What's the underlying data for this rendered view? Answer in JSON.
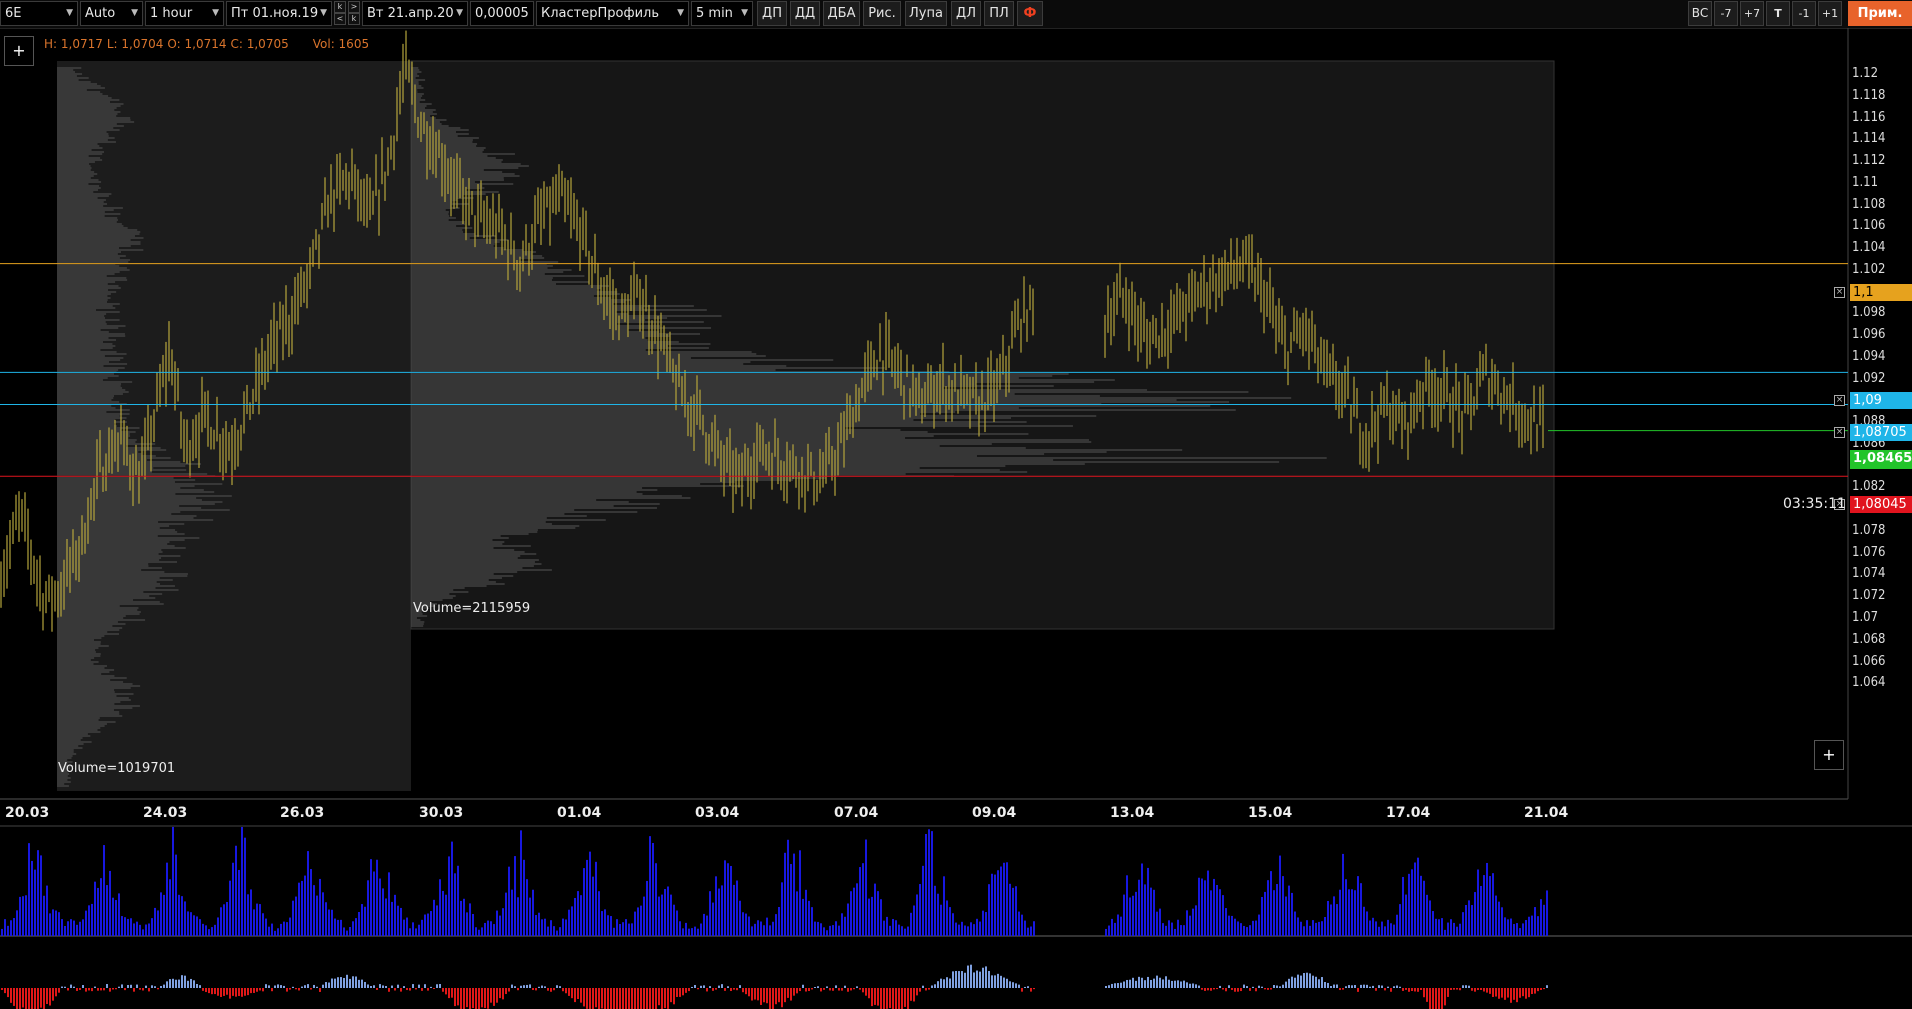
{
  "toolbar": {
    "symbol": "6E",
    "scale_mode": "Auto",
    "timeframe": "1 hour",
    "date_from": "Пт 01.ноя.19",
    "date_to": "Вт 21.апр.20",
    "tick_size": "0,00005",
    "template": "КластерПрофиль",
    "profile_period": "5 min",
    "buttons": [
      "ДП",
      "ДД",
      "ДБА",
      "Рис.",
      "Лупа",
      "ДЛ",
      "ПЛ",
      "Ф"
    ],
    "right_buttons": [
      "ВС",
      "-7",
      "+7",
      "T",
      "-1",
      "+1"
    ],
    "apply_label": "Прим."
  },
  "chart": {
    "ohlc": {
      "high": "H: 1,0717",
      "low": "L: 1,0704",
      "open": "O: 1,0714",
      "close": "C: 1,0705",
      "vol": "Vol: 1605"
    },
    "profile_volumes": [
      "Volume=1019701",
      "Volume=2115959"
    ],
    "timer": "03:35:11",
    "price_ticks": [
      "1.12",
      "1.118",
      "1.116",
      "1.114",
      "1.112",
      "1.11",
      "1.108",
      "1.106",
      "1.104",
      "1.102",
      "1.1",
      "1.098",
      "1.096",
      "1.094",
      "1.092",
      "1.09",
      "1.088",
      "1.086",
      "1.084",
      "1.082",
      "1.08",
      "1.078",
      "1.076",
      "1.074",
      "1.072",
      "1.07",
      "1.068",
      "1.066",
      "1.064"
    ],
    "date_labels": [
      "20.03",
      "24.03",
      "26.03",
      "30.03",
      "01.04",
      "03.04",
      "07.04",
      "09.04",
      "13.04",
      "15.04",
      "17.04",
      "21.04"
    ],
    "level_lines": [
      {
        "label": "1,1",
        "price": 1.1,
        "color": "#e6a21e",
        "text_color": "#000"
      },
      {
        "label": "1,09",
        "price": 1.09,
        "color": "#1fb5e8",
        "text_color": "#fff"
      },
      {
        "label": "1,08705",
        "price": 1.08705,
        "color": "#1fb5e8",
        "text_color": "#fff"
      },
      {
        "label": "1,08045",
        "price": 1.08045,
        "color": "#e0141e",
        "text_color": "#fff"
      }
    ],
    "current_price": {
      "label": "1,08465",
      "price": 1.08465,
      "color": "#22c42a"
    },
    "colors": {
      "candle": "#b5a53c",
      "volume": "#1818e0",
      "delta_pos": "#7fa0e0",
      "delta_neg": "#e01818",
      "profile": "#555555"
    }
  },
  "chart_data": {
    "type": "candlestick",
    "title": "",
    "xlabel": "",
    "ylabel": "",
    "ylim": [
      1.063,
      1.121
    ],
    "x": [
      "20.03",
      "24.03",
      "26.03",
      "30.03",
      "01.04",
      "03.04",
      "07.04",
      "09.04",
      "13.04",
      "15.04",
      "17.04",
      "21.04"
    ],
    "close_path": [
      [
        0,
        1.071
      ],
      [
        20,
        1.077
      ],
      [
        45,
        1.069
      ],
      [
        60,
        1.07
      ],
      [
        80,
        1.074
      ],
      [
        100,
        1.081
      ],
      [
        120,
        1.084
      ],
      [
        140,
        1.08
      ],
      [
        160,
        1.088
      ],
      [
        170,
        1.092
      ],
      [
        185,
        1.083
      ],
      [
        205,
        1.086
      ],
      [
        230,
        1.083
      ],
      [
        250,
        1.087
      ],
      [
        270,
        1.092
      ],
      [
        290,
        1.095
      ],
      [
        310,
        1.099
      ],
      [
        330,
        1.106
      ],
      [
        350,
        1.108
      ],
      [
        370,
        1.104
      ],
      [
        390,
        1.11
      ],
      [
        405,
        1.118
      ],
      [
        420,
        1.113
      ],
      [
        440,
        1.11
      ],
      [
        460,
        1.106
      ],
      [
        480,
        1.104
      ],
      [
        500,
        1.103
      ],
      [
        520,
        1.1
      ],
      [
        540,
        1.104
      ],
      [
        560,
        1.106
      ],
      [
        580,
        1.103
      ],
      [
        600,
        1.098
      ],
      [
        620,
        1.095
      ],
      [
        640,
        1.097
      ],
      [
        660,
        1.093
      ],
      [
        680,
        1.088
      ],
      [
        700,
        1.086
      ],
      [
        720,
        1.082
      ],
      [
        740,
        1.08
      ],
      [
        760,
        1.083
      ],
      [
        780,
        1.082
      ],
      [
        800,
        1.081
      ],
      [
        820,
        1.08
      ],
      [
        840,
        1.083
      ],
      [
        860,
        1.088
      ],
      [
        880,
        1.092
      ],
      [
        900,
        1.09
      ],
      [
        920,
        1.087
      ],
      [
        940,
        1.089
      ],
      [
        960,
        1.088
      ],
      [
        980,
        1.087
      ],
      [
        1000,
        1.089
      ],
      [
        1020,
        1.095
      ],
      [
        1035,
        1.096
      ],
      [
        1105,
        1.095
      ],
      [
        1125,
        1.097
      ],
      [
        1145,
        1.093
      ],
      [
        1165,
        1.094
      ],
      [
        1185,
        1.096
      ],
      [
        1205,
        1.098
      ],
      [
        1225,
        1.099
      ],
      [
        1245,
        1.1
      ],
      [
        1265,
        1.097
      ],
      [
        1285,
        1.092
      ],
      [
        1305,
        1.094
      ],
      [
        1325,
        1.09
      ],
      [
        1345,
        1.088
      ],
      [
        1365,
        1.084
      ],
      [
        1385,
        1.087
      ],
      [
        1405,
        1.085
      ],
      [
        1425,
        1.089
      ],
      [
        1445,
        1.088
      ],
      [
        1465,
        1.086
      ],
      [
        1485,
        1.09
      ],
      [
        1505,
        1.088
      ],
      [
        1525,
        1.086
      ],
      [
        1545,
        1.0847
      ]
    ]
  }
}
